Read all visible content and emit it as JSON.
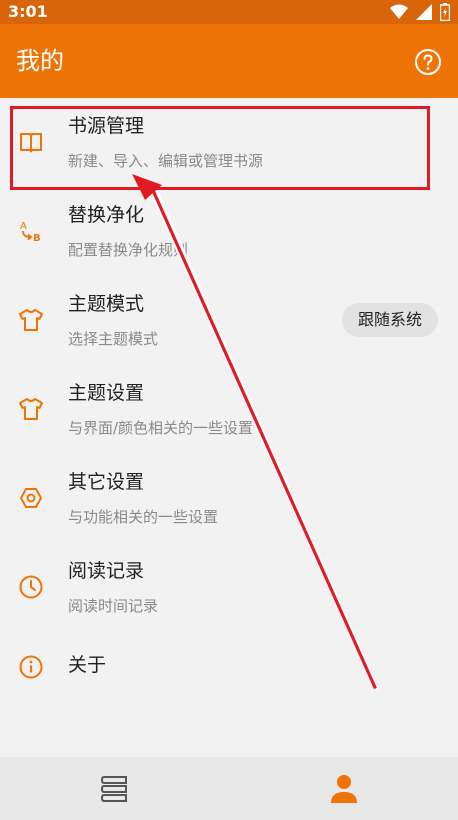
{
  "status_bar": {
    "time": "3:01",
    "icons": [
      "wifi-icon",
      "signal-icon",
      "battery-icon"
    ]
  },
  "app_bar": {
    "title": "我的",
    "help_icon": "help-circle-icon"
  },
  "menu": [
    {
      "title": "书源管理",
      "subtitle": "新建、导入、编辑或管理书源",
      "icon": "book-icon"
    },
    {
      "title": "替换净化",
      "subtitle": "配置替换净化规则",
      "icon": "replace-ab-icon"
    },
    {
      "title": "主题模式",
      "subtitle": "选择主题模式",
      "icon": "tshirt-icon",
      "value": "跟随系统"
    },
    {
      "title": "主题设置",
      "subtitle": "与界面/颜色相关的一些设置",
      "icon": "tshirt-icon"
    },
    {
      "title": "其它设置",
      "subtitle": "与功能相关的一些设置",
      "icon": "settings-hex-icon"
    },
    {
      "title": "阅读记录",
      "subtitle": "阅读时间记录",
      "icon": "clock-icon"
    },
    {
      "title": "关于",
      "icon": "info-icon"
    }
  ],
  "bottom_nav": [
    {
      "icon": "bookshelf-icon",
      "selected": false
    },
    {
      "icon": "person-icon",
      "selected": true
    }
  ],
  "colors": {
    "accent": "#ef7408",
    "status_bar": "#d9650a",
    "highlight": "#e01b24"
  }
}
